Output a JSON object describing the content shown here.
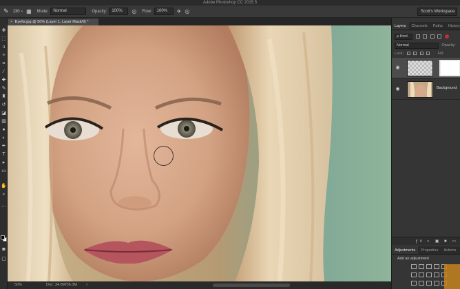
{
  "app": {
    "title": "Adobe Photoshop CC 2015.5"
  },
  "options_bar": {
    "brush_size": "130",
    "mode_label": "Mode:",
    "mode_value": "Normal",
    "opacity_label": "Opacity:",
    "opacity_value": "100%",
    "flow_label": "Flow:",
    "flow_value": "100%",
    "workspace": "Scott's Workspace"
  },
  "document": {
    "tab_title": "Eyefix.jpg @ 50% (Layer 1, Layer Mask/8) *",
    "close_glyph": "×"
  },
  "status": {
    "zoom": "50%",
    "doc_size": "Doc: 34.0M/36.3M",
    "arrow": "›"
  },
  "layers_panel": {
    "tabs": [
      "Layers",
      "Channels",
      "Paths",
      "History"
    ],
    "filter_kind": "ρ Kind",
    "blend_mode": "Normal",
    "opacity_label": "Opacity:",
    "lock_label": "Lock:",
    "fill_label": "Fill:",
    "layers": [
      {
        "name": "",
        "visible": true
      },
      {
        "name": "Background",
        "visible": true
      }
    ],
    "footer_icons": "ƒx ◐ ▣ ■ ▭"
  },
  "adjustments_panel": {
    "tabs": [
      "Adjustments",
      "Properties",
      "Actions"
    ],
    "title": "Add an adjustment"
  },
  "icons": {
    "brush_tool": "paintbrush-icon",
    "eye": "eye-icon"
  },
  "colors": {
    "ui_dark": "#2e2e2e",
    "panel": "#353535",
    "selected_layer": "#4c4c4c",
    "accent_orange": "#c4821f"
  }
}
